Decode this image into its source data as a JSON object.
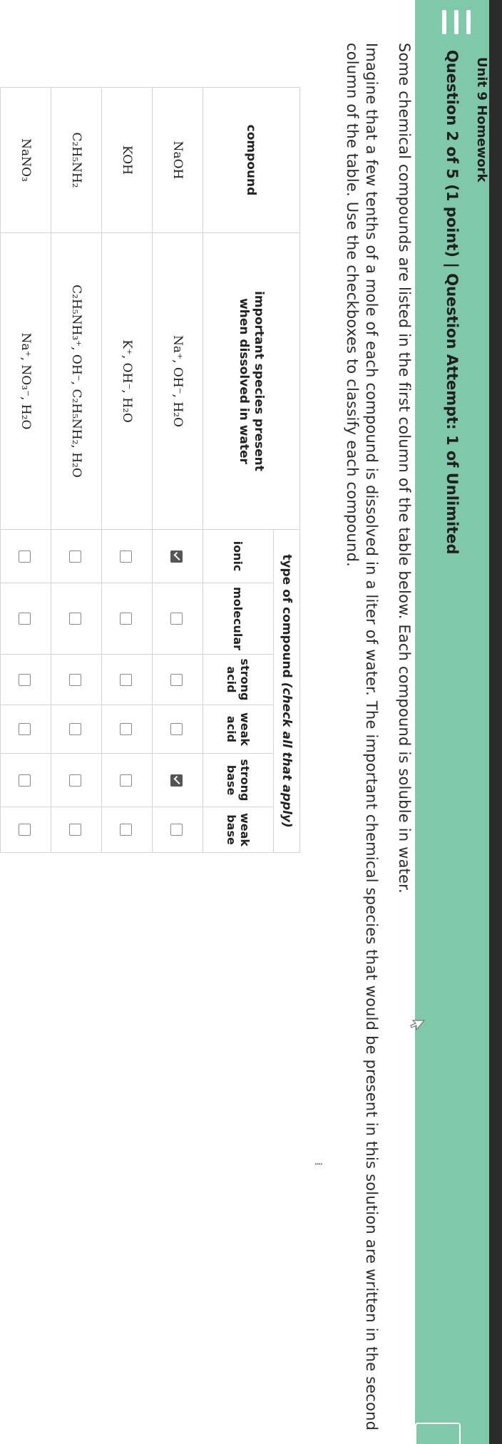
{
  "header": {
    "section": "Unit 9 Homework",
    "title": "Question 2 of 5 (1 point)  |  Question Attempt: 1 of Unlimited",
    "accent_color": "#7fc8a9",
    "menu_icon": "hamburger-menu-icon"
  },
  "prompt": {
    "p1": "Some chemical compounds are listed in the first column of the table below. Each compound is soluble in water.",
    "p2": "Imagine that a few tenths of a mole of each compound is dissolved in a liter of water. The important chemical species that would be present in this solution are written in the second column of the table. Use the checkboxes to classify each compound."
  },
  "table": {
    "compound_header": "compound",
    "species_header_1": "important species present",
    "species_header_2": "when dissolved in water",
    "type_header": "type of compound",
    "type_header_hint": "(check all that apply)",
    "type_columns": [
      {
        "l1": "ionic",
        "l2": ""
      },
      {
        "l1": "molecular",
        "l2": ""
      },
      {
        "l1": "strong",
        "l2": "acid"
      },
      {
        "l1": "weak",
        "l2": "acid"
      },
      {
        "l1": "strong",
        "l2": "base"
      },
      {
        "l1": "weak",
        "l2": "base"
      }
    ],
    "rows": [
      {
        "compound": "NaOH",
        "species": "Na⁺, OH⁻, H₂O",
        "checks": [
          true,
          false,
          false,
          false,
          true,
          false
        ]
      },
      {
        "compound": "KOH",
        "species": "K⁺, OH⁻, H₂O",
        "checks": [
          false,
          false,
          false,
          false,
          false,
          false
        ]
      },
      {
        "compound": "C₂H₅NH₂",
        "species": "C₂H₅NH₃⁺, OH⁻, C₂H₅NH₂, H₂O",
        "checks": [
          false,
          false,
          false,
          false,
          false,
          false
        ]
      },
      {
        "compound": "NaNO₃",
        "species": "Na⁺, NO₃⁻, H₂O",
        "checks": [
          false,
          false,
          false,
          false,
          false,
          false
        ]
      }
    ]
  }
}
